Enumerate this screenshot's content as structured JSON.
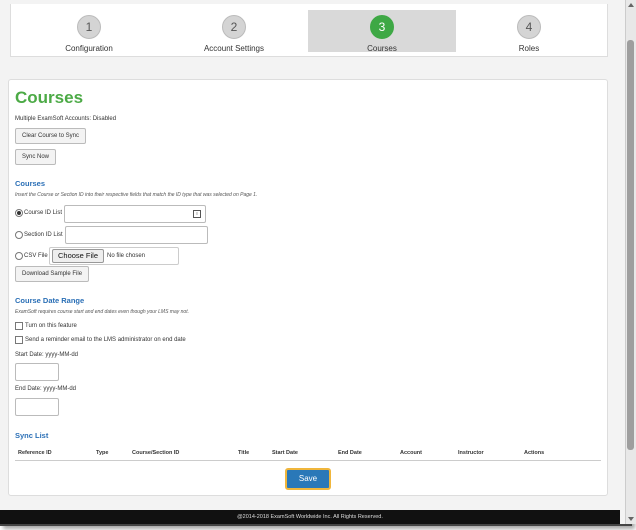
{
  "wizard": {
    "steps": [
      {
        "num": "1",
        "label": "Configuration"
      },
      {
        "num": "2",
        "label": "Account Settings"
      },
      {
        "num": "3",
        "label": "Courses"
      },
      {
        "num": "4",
        "label": "Roles"
      }
    ],
    "active_step": "3"
  },
  "page_title": "Courses",
  "multiple_accounts": "Multiple ExamSoft Accounts: Disabled",
  "buttons": {
    "clear_course": "Clear Course to Sync",
    "sync_now": "Sync Now",
    "download_sample": "Download Sample File",
    "save": "Save"
  },
  "courses_section": {
    "title": "Courses",
    "help": "Insert the Course or Section ID into their respective fields that match the ID type that was selected on Page 1.",
    "course_id_label": "Course ID List",
    "section_id_label": "Section ID List",
    "csv_label": "CSV File",
    "choose_file": "Choose File",
    "no_file": "No file chosen",
    "selected": "course_id"
  },
  "date_range": {
    "title": "Course Date Range",
    "help": "ExamSoft requires course start and end dates even though your LMS may not.",
    "turn_on": "Turn on this feature",
    "reminder": "Send a reminder email to the LMS administrator on end date",
    "start_label": "Start Date: yyyy-MM-dd",
    "end_label": "End Date: yyyy-MM-dd"
  },
  "sync_list": {
    "title": "Sync List",
    "columns": [
      "Reference ID",
      "Type",
      "Course/Section ID",
      "Title",
      "Start Date",
      "End Date",
      "Account",
      "Instructor",
      "Actions"
    ]
  },
  "footer": "@2014-2018 ExamSoft Worldwide Inc. All Rights Reserved.",
  "colors": {
    "accent_green": "#4caa46",
    "section_blue": "#2a6fb6",
    "save_blue": "#2a78b8",
    "save_border": "#f0b63c"
  }
}
